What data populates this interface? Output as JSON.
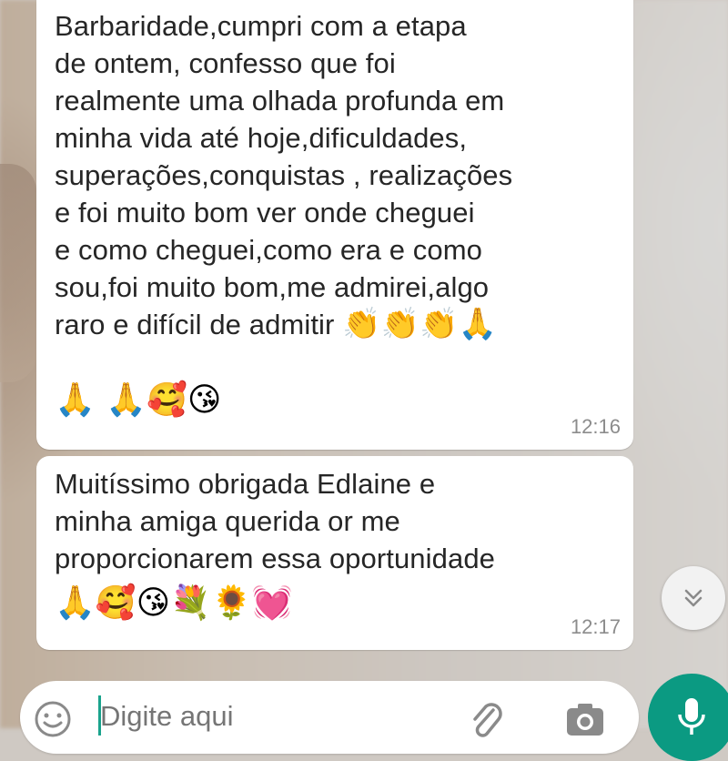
{
  "messages": [
    {
      "text": "Barbaridade,cumpri com a  etapa\nde ontem, confesso que foi\nrealmente uma olhada profunda em\nminha vida até hoje,dificuldades,\nsuperações,conquistas , realizações\ne foi muito bom ver onde cheguei\ne como cheguei,como era e como\nsou,foi muito bom,me admirei,algo\nraro e difícil de admitir ",
      "inline_emojis": "👏👏👏🙏",
      "emoji_line": "🙏 🙏🥰😘",
      "time": "12:16"
    },
    {
      "text": "Muitíssimo obrigada Edlaine e\nminha amiga querida              or me\nproporcionarem essa oportunidade",
      "emoji_line": "🙏🥰😘💐🌻💓",
      "time": "12:17"
    }
  ],
  "input": {
    "placeholder": "Digite aqui"
  },
  "icons": {
    "scroll": "chevron-double-down-icon",
    "emoji": "emoji-icon",
    "attach": "paperclip-icon",
    "camera": "camera-icon",
    "mic": "microphone-icon"
  },
  "colors": {
    "accent": "#0b9a82",
    "bubble": "#ffffff",
    "timestamp": "#8c8c8c"
  }
}
